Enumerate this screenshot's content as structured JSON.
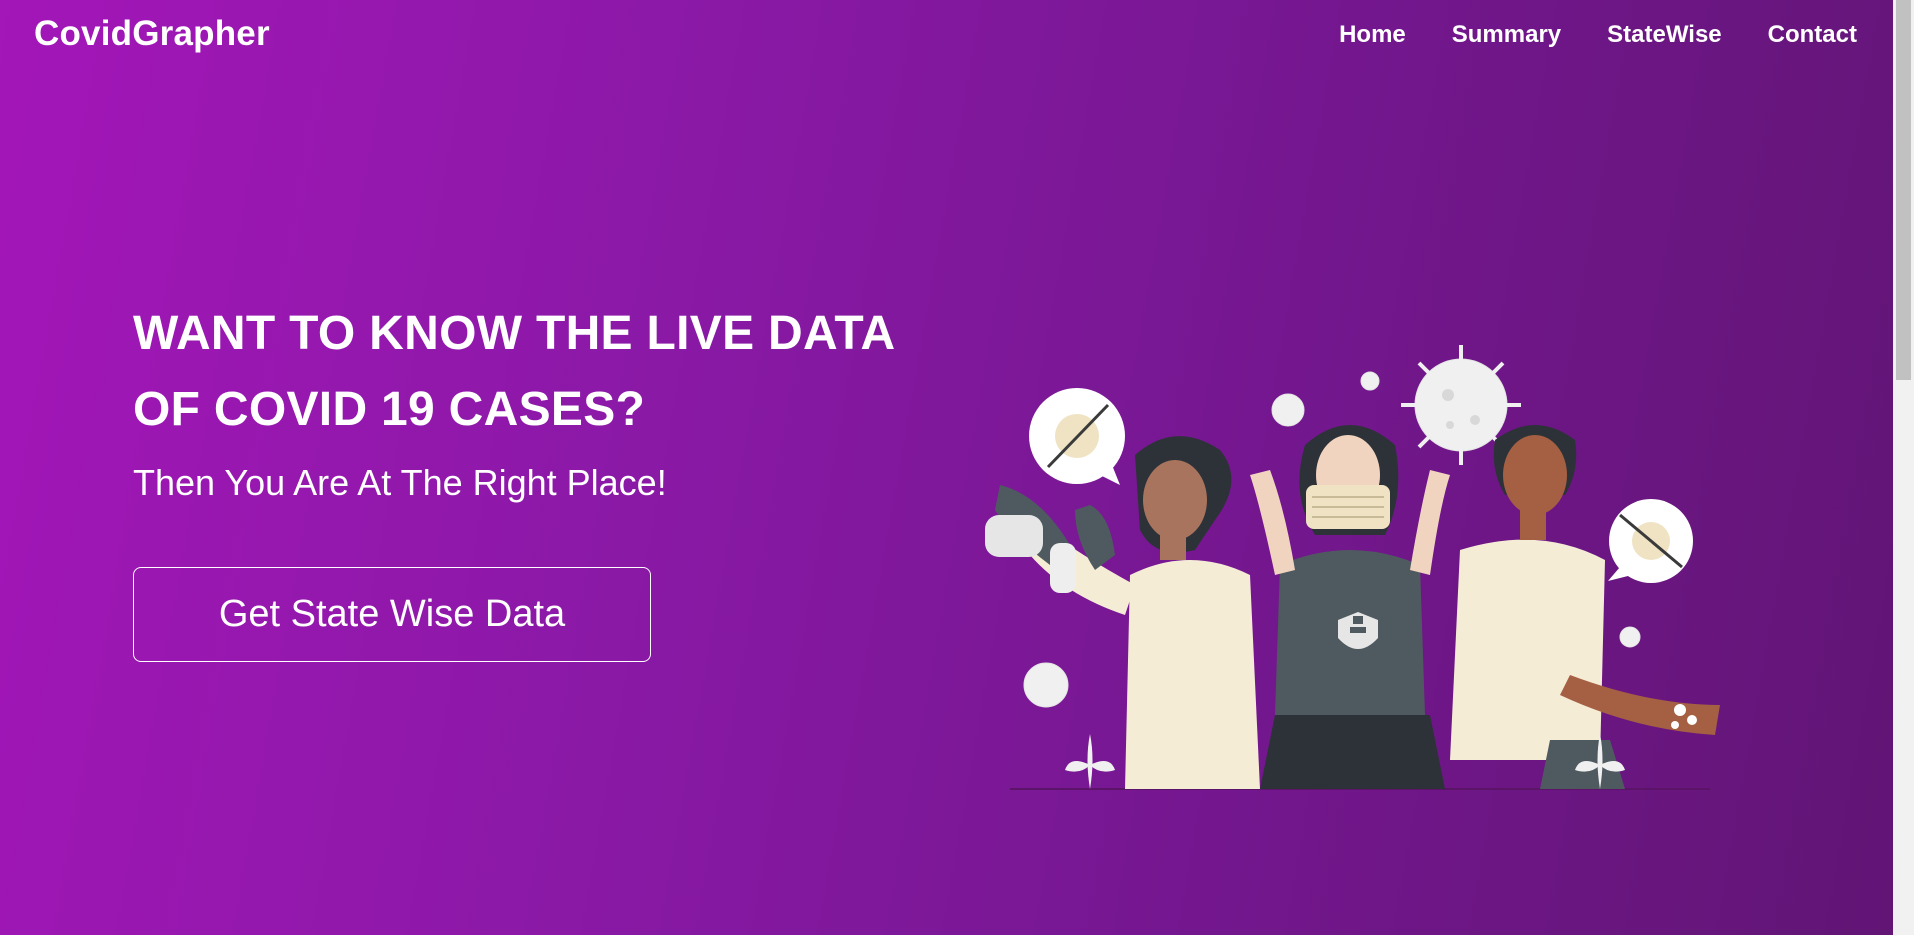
{
  "navbar": {
    "brand": "CovidGrapher",
    "links": [
      "Home",
      "Summary",
      "StateWise",
      "Contact"
    ]
  },
  "hero": {
    "headline": "WANT TO KNOW THE LIVE DATA OF COVID 19 CASES?",
    "subheadline": "Then You Are At The Right Place!",
    "cta_label": "Get State Wise Data"
  },
  "colors": {
    "gradient_start": "#a316b8",
    "gradient_end": "#611574",
    "text": "#ffffff"
  },
  "illustration": {
    "icon": "covid-safety-people-illustration"
  }
}
